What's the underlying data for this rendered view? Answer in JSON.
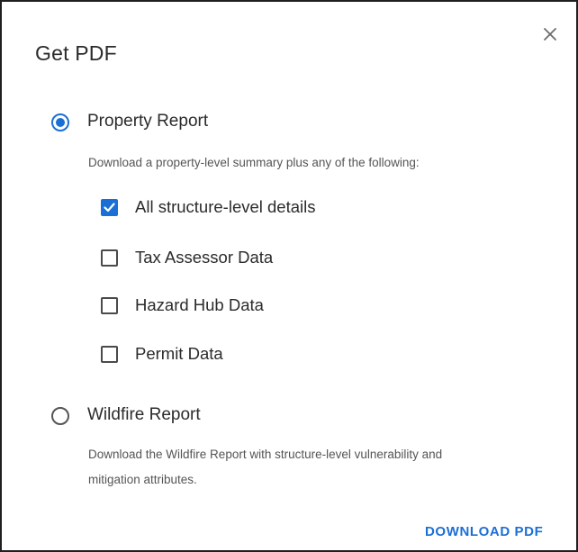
{
  "dialog": {
    "title": "Get PDF",
    "close_icon": "close-icon"
  },
  "options": {
    "property_report": {
      "label": "Property Report",
      "selected": true,
      "description": "Download a property-level summary plus any of the following:",
      "checkboxes": [
        {
          "label": "All structure-level details",
          "checked": true
        },
        {
          "label": "Tax Assessor Data",
          "checked": false
        },
        {
          "label": "Hazard Hub Data",
          "checked": false
        },
        {
          "label": "Permit Data",
          "checked": false
        }
      ]
    },
    "wildfire_report": {
      "label": "Wildfire Report",
      "selected": false,
      "description_line1": "Download the Wildfire Report with structure-level vulnerability and",
      "description_line2": "mitigation attributes."
    }
  },
  "actions": {
    "download_label": "DOWNLOAD PDF"
  },
  "colors": {
    "accent": "#1a6fd6",
    "text": "#2b2b2b",
    "muted": "#555555"
  }
}
